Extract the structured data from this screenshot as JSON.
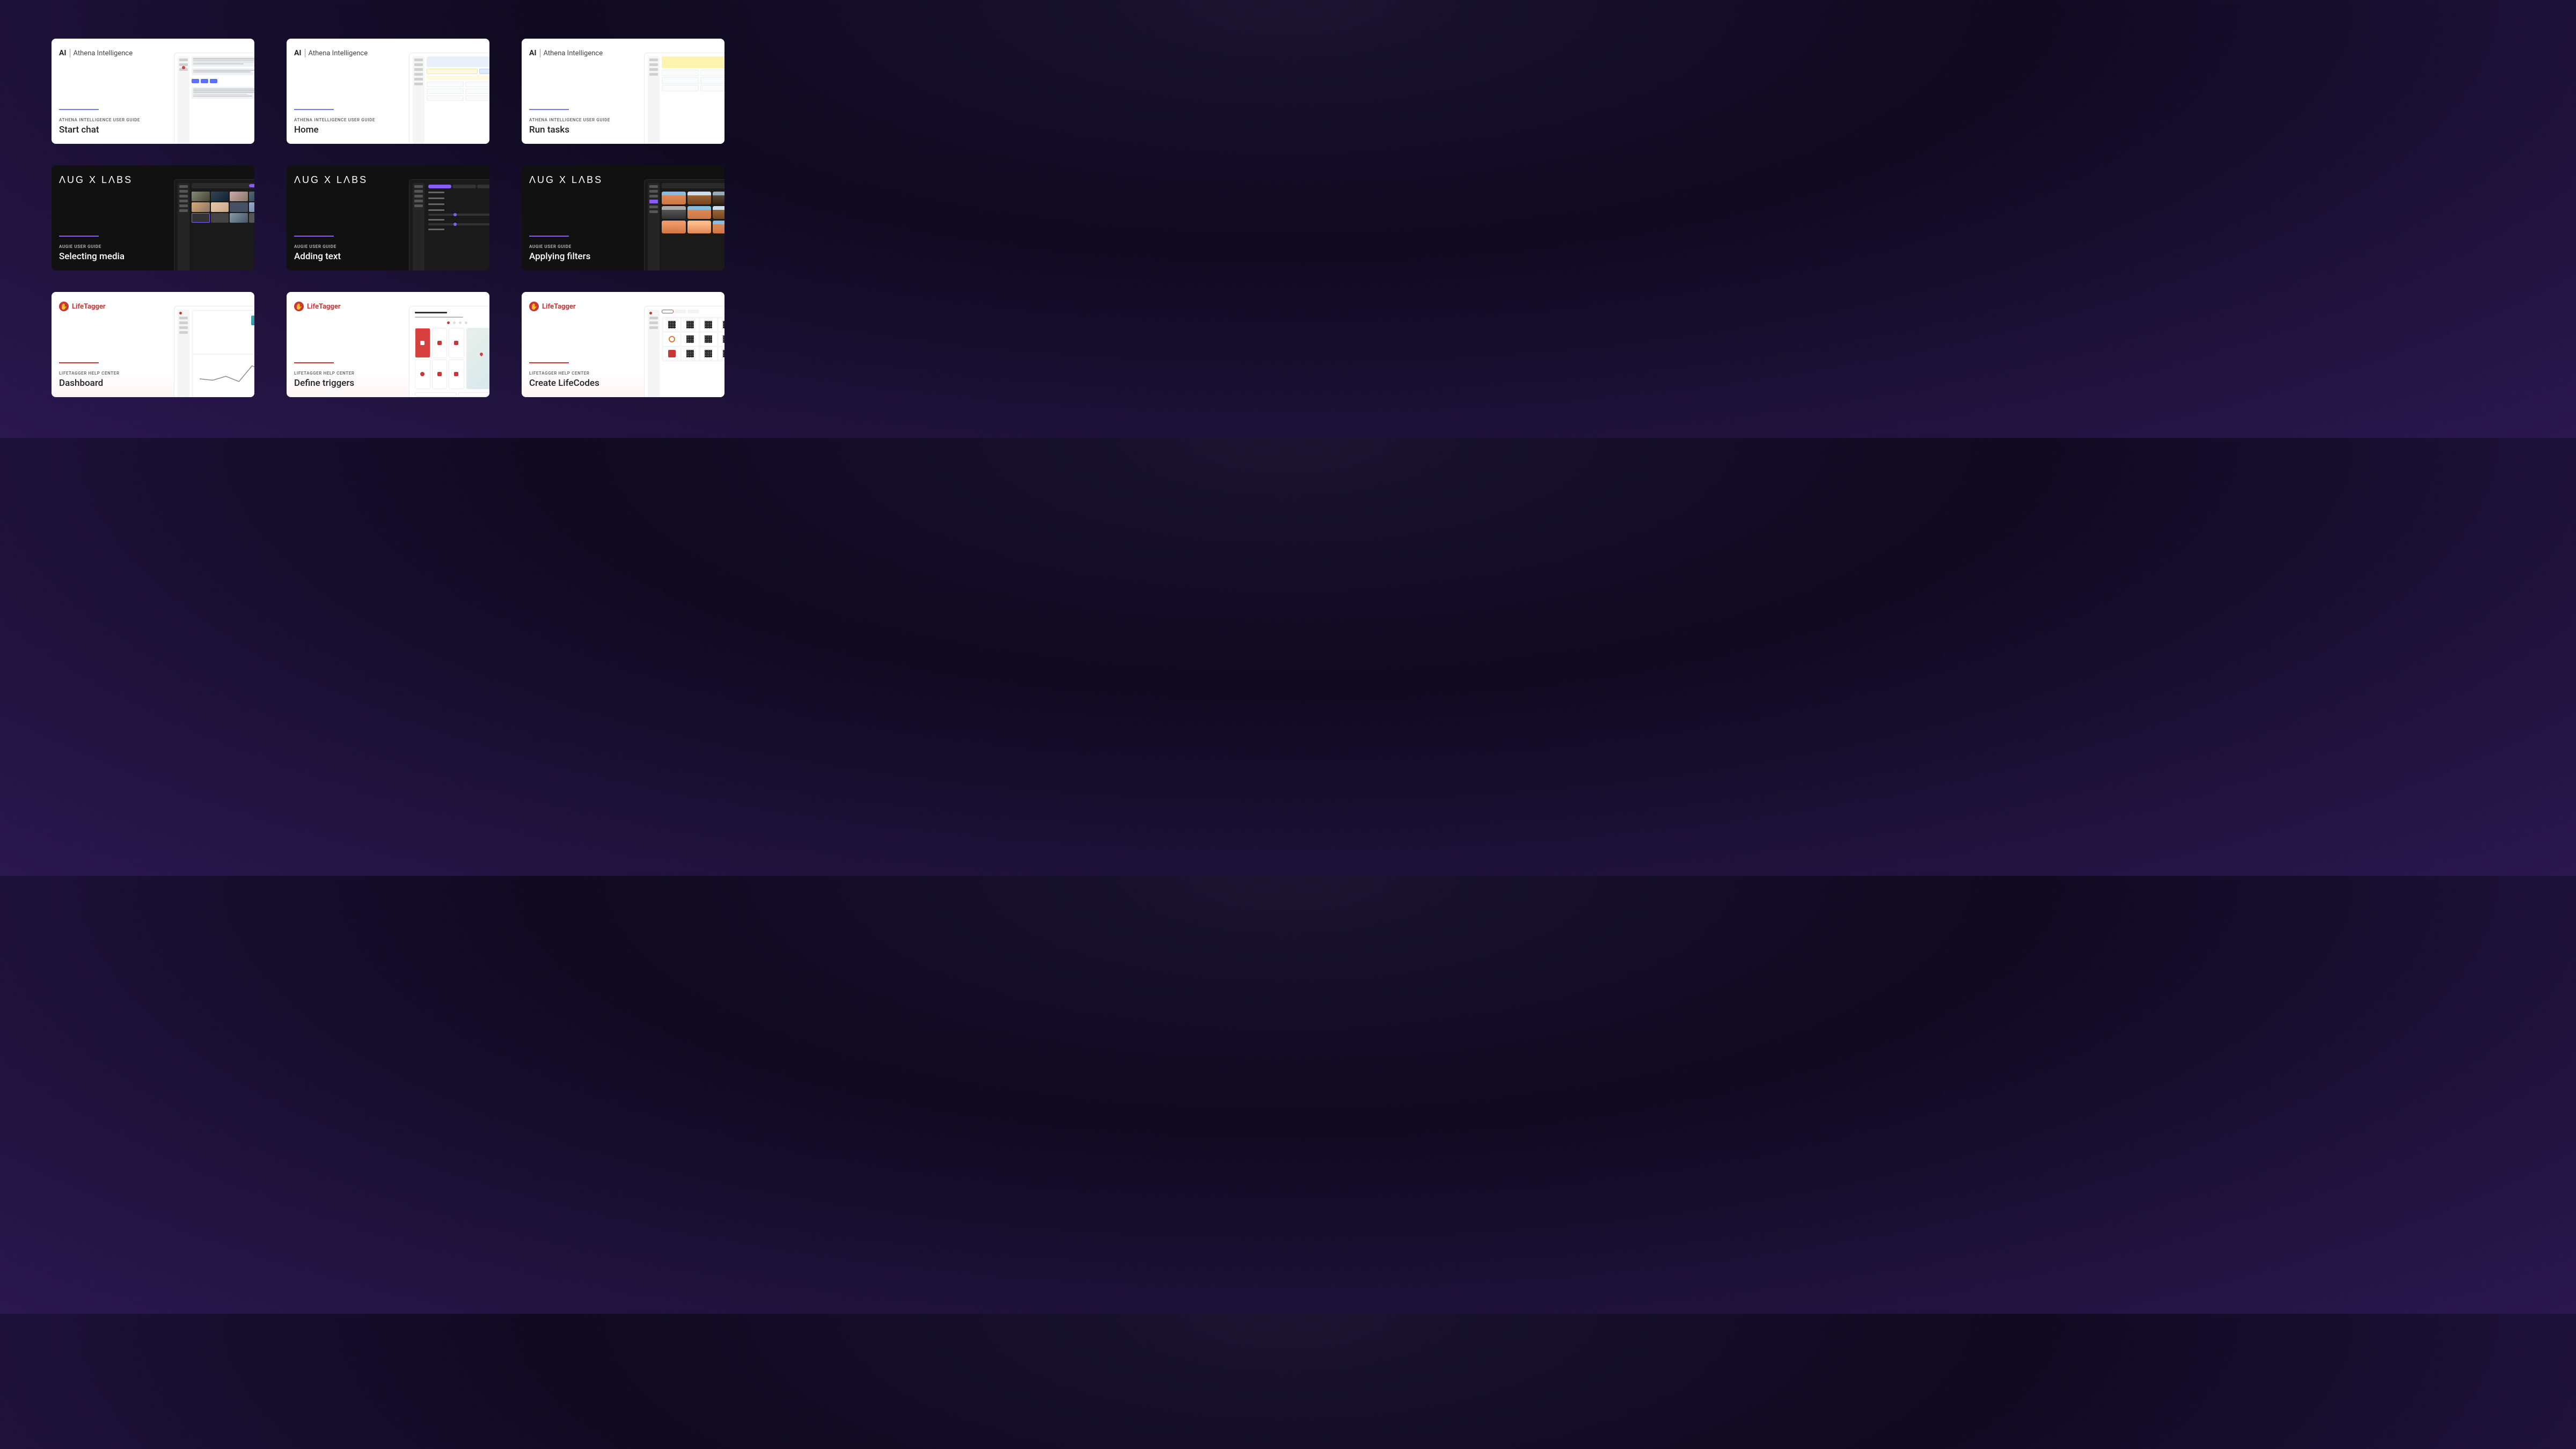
{
  "brands": {
    "athena": {
      "mark": "AI",
      "name": "Athena Intelligence",
      "category": "ATHENA INTELLIGENCE USER GUIDE"
    },
    "augx": {
      "name": "ΛUG X LΛBS",
      "category": "AUGIE USER GUIDE"
    },
    "lifetagger": {
      "name": "LifeTagger",
      "category": "LIFETAGGER HELP CENTER"
    }
  },
  "cards": [
    {
      "title": "Start chat"
    },
    {
      "title": "Home"
    },
    {
      "title": "Run tasks"
    },
    {
      "title": "Selecting media"
    },
    {
      "title": "Adding text"
    },
    {
      "title": "Applying filters"
    },
    {
      "title": "Dashboard"
    },
    {
      "title": "Define triggers"
    },
    {
      "title": "Create LifeCodes"
    }
  ]
}
